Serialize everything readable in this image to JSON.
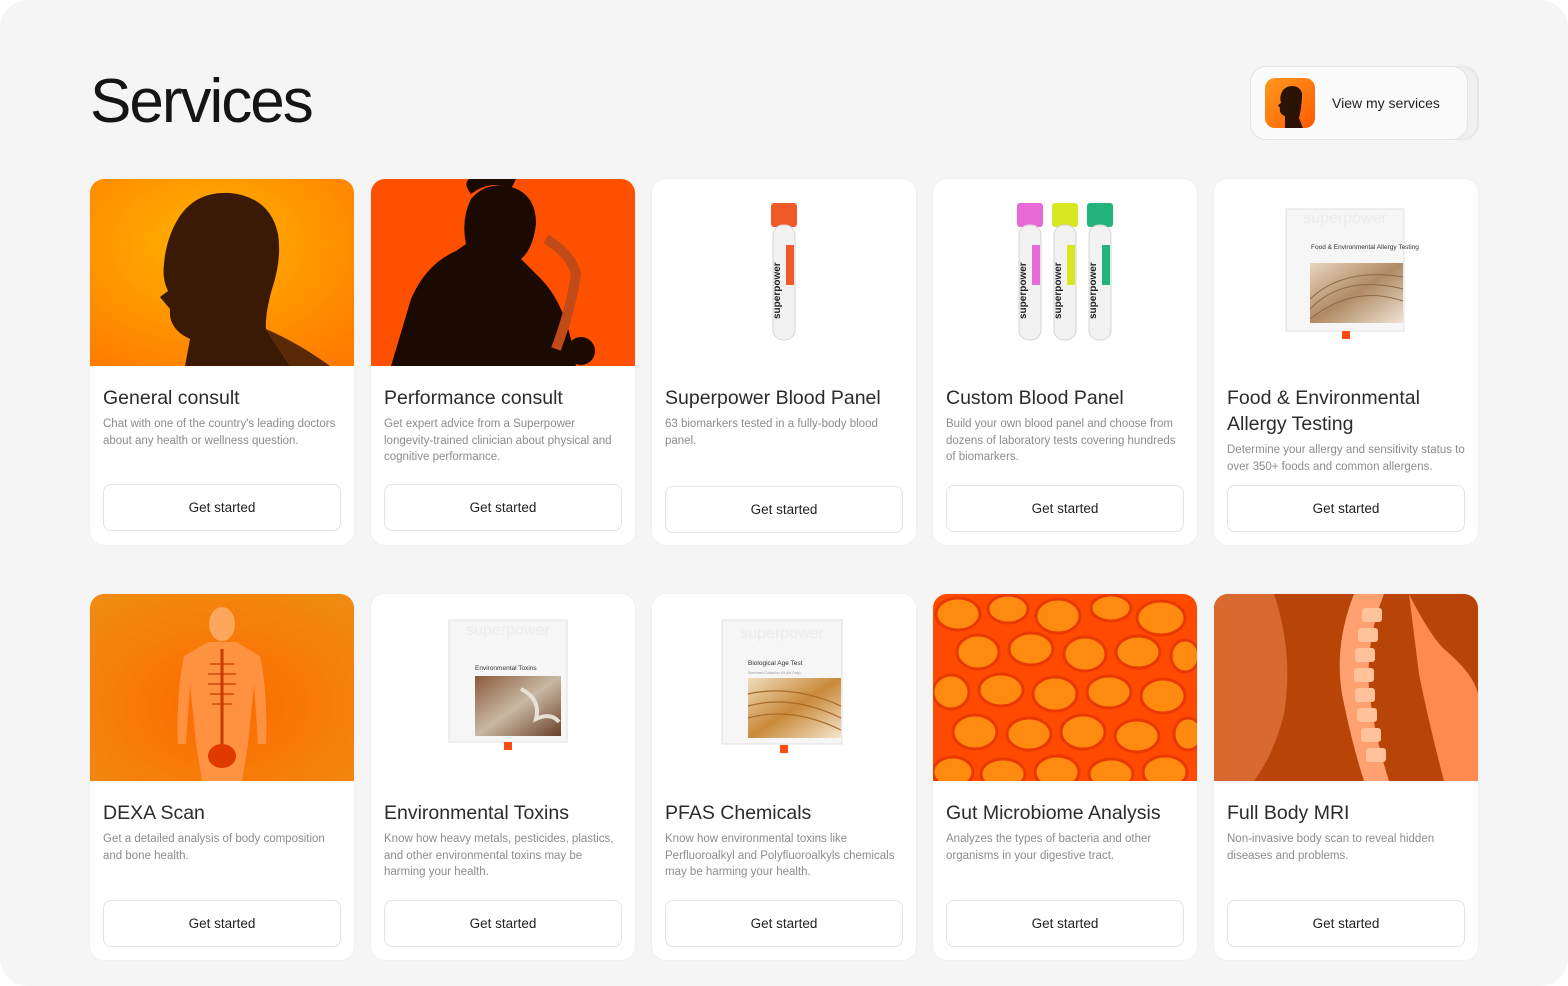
{
  "header": {
    "title": "Services",
    "view_button_label": "View my services"
  },
  "services": [
    {
      "title": "General consult",
      "desc": "Chat with one of the country's leading doctors about any health or wellness question.",
      "cta": "Get started",
      "image": "orange-head-silhouette"
    },
    {
      "title": "Performance consult",
      "desc": "Get expert advice from a Superpower longevity-trained clinician about physical and cognitive performance.",
      "cta": "Get started",
      "image": "athlete-mask-silhouette"
    },
    {
      "title": "Superpower Blood Panel",
      "desc": "63 biomarkers tested in a fully-body blood panel.",
      "cta": "Get started",
      "image": "single-blood-tube",
      "tube_brand": "superpower"
    },
    {
      "title": "Custom Blood Panel",
      "desc": "Build your own blood panel and choose from dozens of laboratory tests covering hundreds of biomarkers.",
      "cta": "Get started",
      "image": "three-blood-tubes",
      "tube_brand": "superpower"
    },
    {
      "title": "Food & Environmental Allergy Testing",
      "desc": "Determine your allergy and sensitivity status to over 350+ foods and common allergens.",
      "cta": "Get started",
      "image": "allergy-test-box",
      "box_brand": "superpower",
      "box_label": "Food & Environmental Allergy Testing"
    },
    {
      "title": "DEXA Scan",
      "desc": "Get a detailed analysis of body composition and bone health.",
      "cta": "Get started",
      "image": "body-xray"
    },
    {
      "title": "Environmental Toxins",
      "desc": "Know how heavy metals, pesticides, plastics, and other environmental toxins may be harming your health.",
      "cta": "Get started",
      "image": "toxins-test-box",
      "box_brand": "superpower",
      "box_label": "Environmental Toxins"
    },
    {
      "title": "PFAS Chemicals",
      "desc": "Know how environmental toxins like Perfluoroalkyl and Polyfluoroalkyls chemicals may be harming your health.",
      "cta": "Get started",
      "image": "bio-age-test-box",
      "box_brand": "superpower",
      "box_label": "Biological Age Test",
      "box_sublabel": "Specimen Collection Kit (Kit Only)"
    },
    {
      "title": "Gut Microbiome Analysis",
      "desc": "Analyzes the types of bacteria and other organisms in your digestive tract.",
      "cta": "Get started",
      "image": "microbiome-cells"
    },
    {
      "title": "Full Body MRI",
      "desc": "Non-invasive body scan to reveal hidden diseases and problems.",
      "cta": "Get started",
      "image": "spine-mri"
    }
  ],
  "colors": {
    "accent": "#ff5a00",
    "accent_light": "#ff9a1f",
    "tube_red": "#f05a28",
    "tube_pink": "#e86ad8",
    "tube_yellow": "#d8e820",
    "tube_green": "#22b47a"
  }
}
